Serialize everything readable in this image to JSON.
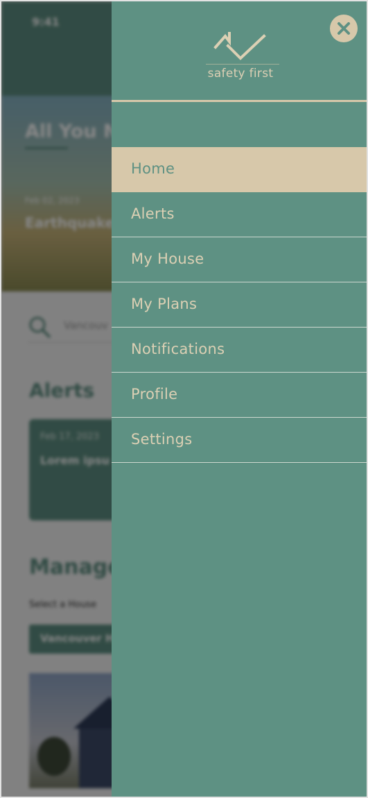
{
  "colors": {
    "drawer_bg": "#5e9183",
    "accent_sand": "#d7c8aa",
    "menu_text": "#dcd0b4",
    "active_text": "#5e9183",
    "overlay": "rgba(0,0,0,0.47)"
  },
  "background_app": {
    "status_time": "9:41",
    "hero_title": "All You N",
    "hero_date": "Feb 02, 2023",
    "hero_headline": "Earthquake coming to B",
    "search_placeholder": "Vancouv",
    "alerts_heading": "Alerts",
    "alert_card": {
      "date": "Feb 17, 2023",
      "text": "Lorem ipsu consectetu"
    },
    "manage_heading": "Manage",
    "select_label": "Select a House",
    "house_select_value": "Vancouver H"
  },
  "drawer": {
    "close_icon": "close-x-icon",
    "logo_icon": "house-checkmark-icon",
    "logo_text": "safety first",
    "menu": [
      {
        "label": "Home",
        "active": true
      },
      {
        "label": "Alerts",
        "active": false
      },
      {
        "label": "My House",
        "active": false
      },
      {
        "label": "My Plans",
        "active": false
      },
      {
        "label": "Notifications",
        "active": false
      },
      {
        "label": "Profile",
        "active": false
      },
      {
        "label": "Settings",
        "active": false
      }
    ]
  }
}
